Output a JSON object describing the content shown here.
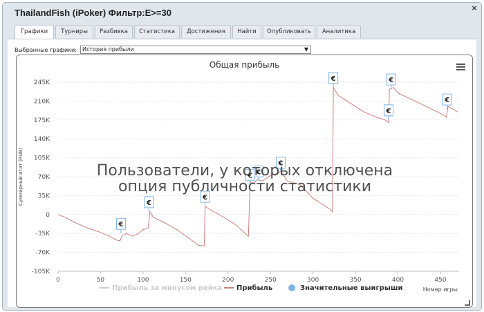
{
  "window": {
    "title": "ThailandFish (iPoker) Фильтр:E>=30",
    "close_glyph": "×"
  },
  "tabs": [
    {
      "label": "Графики",
      "active": true
    },
    {
      "label": "Турниры"
    },
    {
      "label": "Разбивка"
    },
    {
      "label": "Статистика"
    },
    {
      "label": "Достижения"
    },
    {
      "label": "Найти"
    },
    {
      "label": "Опубликовать"
    },
    {
      "label": "Аналитика"
    }
  ],
  "graph_selector": {
    "label": "Выбранные графики:",
    "value": "История прибыли",
    "chevron_icon": "chevron-down-icon"
  },
  "overlay_text": [
    "Пользователи, у которых отключена",
    "опция публичности статистики"
  ],
  "menu_icon": "hamburger-icon",
  "chart_data": {
    "type": "line",
    "title": "Общая прибыль",
    "xlabel": "Номер игры",
    "ylabel": "Суммарный игат (RUB)",
    "xlim": [
      0,
      472
    ],
    "ylim": [
      -105000,
      245000
    ],
    "x_ticks": [
      0,
      50,
      100,
      150,
      200,
      250,
      300,
      350,
      400,
      450
    ],
    "y_ticks": [
      -105000,
      -70000,
      -35000,
      0,
      35000,
      70000,
      105000,
      140000,
      175000,
      210000,
      245000
    ],
    "y_tick_labels": [
      "-105K",
      "-70K",
      "-35K",
      "0",
      "35K",
      "70K",
      "105K",
      "140K",
      "175K",
      "210K",
      "245K"
    ],
    "grid": true,
    "legend_position": "bottom",
    "series": [
      {
        "name": "Прибыль",
        "color": "#c9807a",
        "points": [
          [
            0,
            0
          ],
          [
            8,
            -5000
          ],
          [
            20,
            -15000
          ],
          [
            35,
            -25000
          ],
          [
            50,
            -33000
          ],
          [
            60,
            -40000
          ],
          [
            70,
            -48000
          ],
          [
            73,
            -48000
          ],
          [
            75,
            -40000
          ],
          [
            80,
            -35000
          ],
          [
            88,
            -40000
          ],
          [
            95,
            -35000
          ],
          [
            100,
            -28000
          ],
          [
            106,
            -25000
          ],
          [
            108,
            5000
          ],
          [
            112,
            -5000
          ],
          [
            125,
            -15000
          ],
          [
            140,
            -28000
          ],
          [
            155,
            -45000
          ],
          [
            165,
            -57000
          ],
          [
            172,
            -58000
          ],
          [
            173,
            15000
          ],
          [
            180,
            8000
          ],
          [
            195,
            -5000
          ],
          [
            210,
            -20000
          ],
          [
            222,
            -38000
          ],
          [
            224,
            -40000
          ],
          [
            226,
            60000
          ],
          [
            230,
            58000
          ],
          [
            235,
            65000
          ],
          [
            240,
            62000
          ],
          [
            250,
            72000
          ],
          [
            258,
            76000
          ],
          [
            262,
            80000
          ],
          [
            270,
            62000
          ],
          [
            285,
            55000
          ],
          [
            300,
            30000
          ],
          [
            315,
            15000
          ],
          [
            320,
            10000
          ],
          [
            323,
            5000
          ],
          [
            324,
            235000
          ],
          [
            330,
            220000
          ],
          [
            345,
            205000
          ],
          [
            360,
            190000
          ],
          [
            375,
            180000
          ],
          [
            385,
            175000
          ],
          [
            389,
            170000
          ],
          [
            390,
            232000
          ],
          [
            395,
            235000
          ],
          [
            400,
            225000
          ],
          [
            420,
            210000
          ],
          [
            440,
            195000
          ],
          [
            455,
            183000
          ],
          [
            457,
            180000
          ],
          [
            459,
            200000
          ],
          [
            465,
            195000
          ],
          [
            470,
            190000
          ]
        ]
      },
      {
        "name": "Прибыль за минусом рейка",
        "color": "#cccccc",
        "points": []
      },
      {
        "name": "Значительные выигрыши",
        "color": "#7cb5ec",
        "points": []
      }
    ],
    "markers": [
      {
        "x": 74,
        "y": -35000,
        "label": "€"
      },
      {
        "x": 107,
        "y": 5000,
        "label": "€"
      },
      {
        "x": 173,
        "y": 15000,
        "label": "€"
      },
      {
        "x": 226,
        "y": 55000,
        "label": "€"
      },
      {
        "x": 236,
        "y": 62000,
        "label": "€"
      },
      {
        "x": 262,
        "y": 78000,
        "label": "€"
      },
      {
        "x": 324,
        "y": 235000,
        "label": "€"
      },
      {
        "x": 389,
        "y": 175000,
        "label": "€"
      },
      {
        "x": 392,
        "y": 232000,
        "label": "€"
      },
      {
        "x": 458,
        "y": 195000,
        "label": "€"
      }
    ]
  }
}
